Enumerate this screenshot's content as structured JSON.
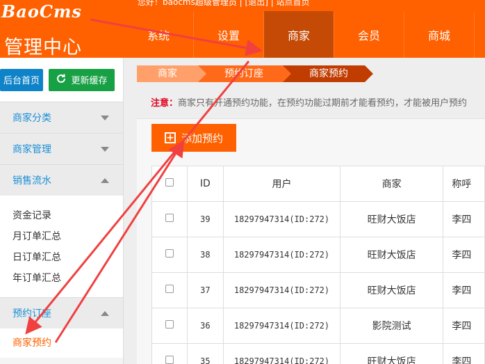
{
  "brand": {
    "logo": "BaoCms",
    "title": "管理中心"
  },
  "topinfo": "您好！baocms超级管理员 | [退出] | 站点首页",
  "nav": [
    {
      "label": "系统",
      "active": false
    },
    {
      "label": "设置",
      "active": false
    },
    {
      "label": "商家",
      "active": true
    },
    {
      "label": "会员",
      "active": false
    },
    {
      "label": "商城",
      "active": false
    }
  ],
  "sidebar": {
    "home_btn": "后台首页",
    "cache_btn": "更新缓存",
    "sections": [
      {
        "label": "商家分类"
      },
      {
        "label": "商家管理"
      },
      {
        "label": "销售流水"
      }
    ],
    "sales_items": [
      "资金记录",
      "月订单汇总",
      "日订单汇总",
      "年订单汇总"
    ],
    "booking_section": "预约订座",
    "booking_items": [
      "商家预约"
    ]
  },
  "breadcrumb": [
    "商家",
    "预约订座",
    "商家预约"
  ],
  "notice": {
    "label": "注意：",
    "text": "商家只有开通预约功能，在预约功能过期前才能看预约，才能被用户预约"
  },
  "add_button": "添加预约",
  "table": {
    "headers": [
      "",
      "ID",
      "用户",
      "商家",
      "称呼"
    ],
    "rows": [
      {
        "id": "39",
        "user": "18297947314(ID:272)",
        "shop": "旺财大饭店",
        "name": "李四"
      },
      {
        "id": "38",
        "user": "18297947314(ID:272)",
        "shop": "旺财大饭店",
        "name": "李四"
      },
      {
        "id": "37",
        "user": "18297947314(ID:272)",
        "shop": "旺财大饭店",
        "name": "李四"
      },
      {
        "id": "36",
        "user": "18297947314(ID:272)",
        "shop": "影院测试",
        "name": "李四"
      },
      {
        "id": "35",
        "user": "18297947314(ID:272)",
        "shop": "旺财大饭店",
        "name": "李四"
      }
    ]
  },
  "colors": {
    "brand": "#ff6000",
    "nav_active": "#c44a05",
    "arrow": "#f04040",
    "link": "#1b8fd6"
  }
}
